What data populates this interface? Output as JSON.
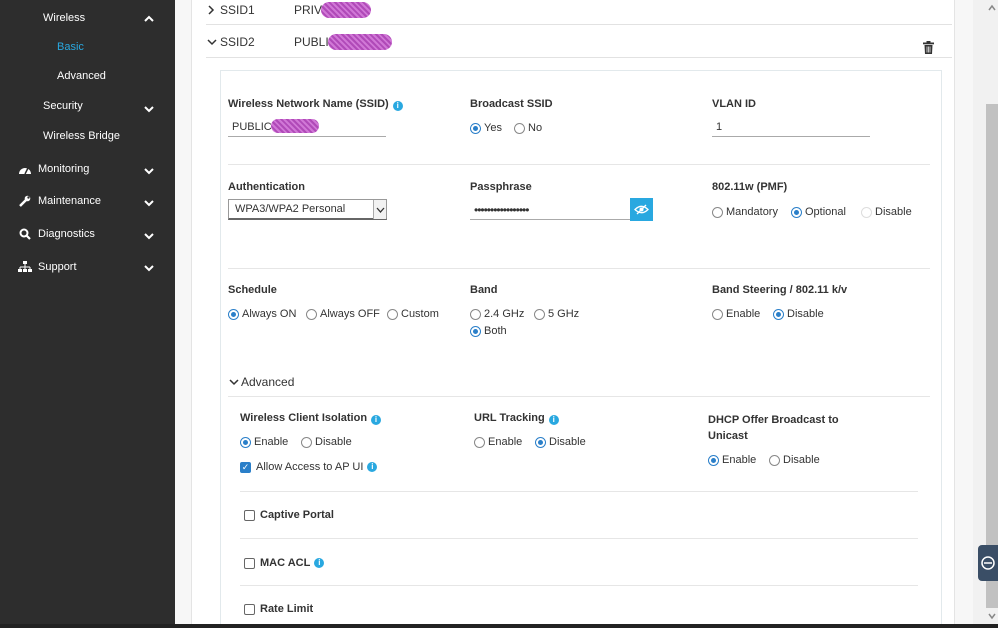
{
  "sidebar": {
    "wireless": "Wireless",
    "basic": "Basic",
    "advanced": "Advanced",
    "security": "Security",
    "wireless_bridge": "Wireless Bridge",
    "monitoring": "Monitoring",
    "maintenance": "Maintenance",
    "diagnostics": "Diagnostics",
    "support": "Support"
  },
  "ssids": [
    {
      "name": "SSID1",
      "value": "PRIV"
    },
    {
      "name": "SSID2",
      "value": "PUBLI"
    }
  ],
  "form": {
    "ssid_label": "Wireless Network Name (SSID)",
    "ssid_value": "PUBLIC",
    "broadcast_label": "Broadcast SSID",
    "broadcast_yes": "Yes",
    "broadcast_no": "No",
    "vlan_label": "VLAN ID",
    "vlan_value": "1",
    "auth_label": "Authentication",
    "auth_value": "WPA3/WPA2 Personal",
    "pass_label": "Passphrase",
    "pass_value": "•••••••••••••••••",
    "pmf_label": "802.11w (PMF)",
    "pmf_mandatory": "Mandatory",
    "pmf_optional": "Optional",
    "pmf_disable": "Disable",
    "schedule_label": "Schedule",
    "sched_on": "Always ON",
    "sched_off": "Always OFF",
    "sched_custom": "Custom",
    "band_label": "Band",
    "band_24": "2.4 GHz",
    "band_5": "5 GHz",
    "band_both": "Both",
    "steer_label": "Band Steering / 802.11 k/v",
    "steer_enable": "Enable",
    "steer_disable": "Disable"
  },
  "advanced": {
    "title": "Advanced",
    "isolation_label": "Wireless Client Isolation",
    "iso_enable": "Enable",
    "iso_disable": "Disable",
    "allow_ap_ui": "Allow Access to AP UI",
    "url_label": "URL Tracking",
    "url_enable": "Enable",
    "url_disable": "Disable",
    "dhcp_label_1": "DHCP Offer Broadcast to",
    "dhcp_label_2": "Unicast",
    "dhcp_enable": "Enable",
    "dhcp_disable": "Disable",
    "captive_portal": "Captive Portal",
    "mac_acl": "MAC ACL",
    "rate_limit": "Rate Limit"
  },
  "colors": {
    "accent": "#29a8e0",
    "sidebar_bg": "#2d2d2d",
    "radio_on": "#2a7fc9"
  },
  "icons": {
    "monitoring": "dashboard-icon",
    "maintenance": "wrench-icon",
    "diagnostics": "search-icon",
    "support": "sitemap-icon",
    "delete": "trash-icon",
    "passphrase": "eye-slash-icon"
  }
}
